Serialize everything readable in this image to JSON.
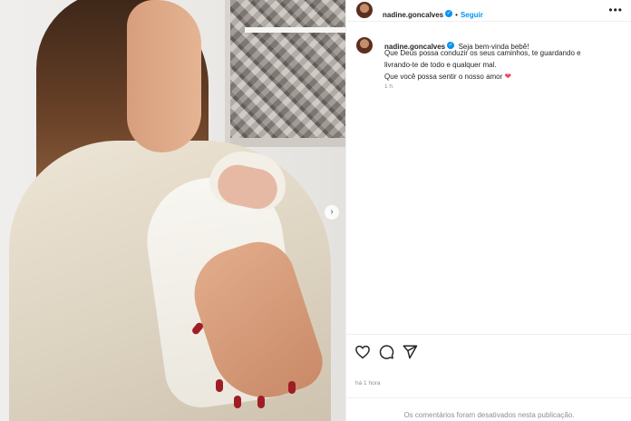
{
  "post": {
    "author": {
      "username": "nadine.goncalves",
      "follow_label": "Seguir",
      "dot": "•"
    },
    "more_icon": "more-horizontal-icon",
    "caption": {
      "username": "nadine.goncalves",
      "first_line": "Seja bem-vinda bebê!",
      "body_lines": [
        "Que Deus possa conduzir os seus caminhos, te guardando e",
        "livrando-te de todo e qualquer mal.",
        "Que você possa sentir o nosso amor"
      ],
      "emoji": "❤",
      "time_ago": "1 h"
    },
    "actions": {
      "like_icon": "heart-outline-icon",
      "comment_icon": "comment-icon",
      "share_icon": "send-icon"
    },
    "timestamp": "há 1 hora",
    "comments_disabled": "Os comentários foram desativados nesta publicação.",
    "carousel_next_icon": "chevron-right-icon"
  },
  "colors": {
    "accent": "#0095f6",
    "heart": "#ed4956",
    "muted": "#8e8e8e",
    "text": "#262626"
  }
}
